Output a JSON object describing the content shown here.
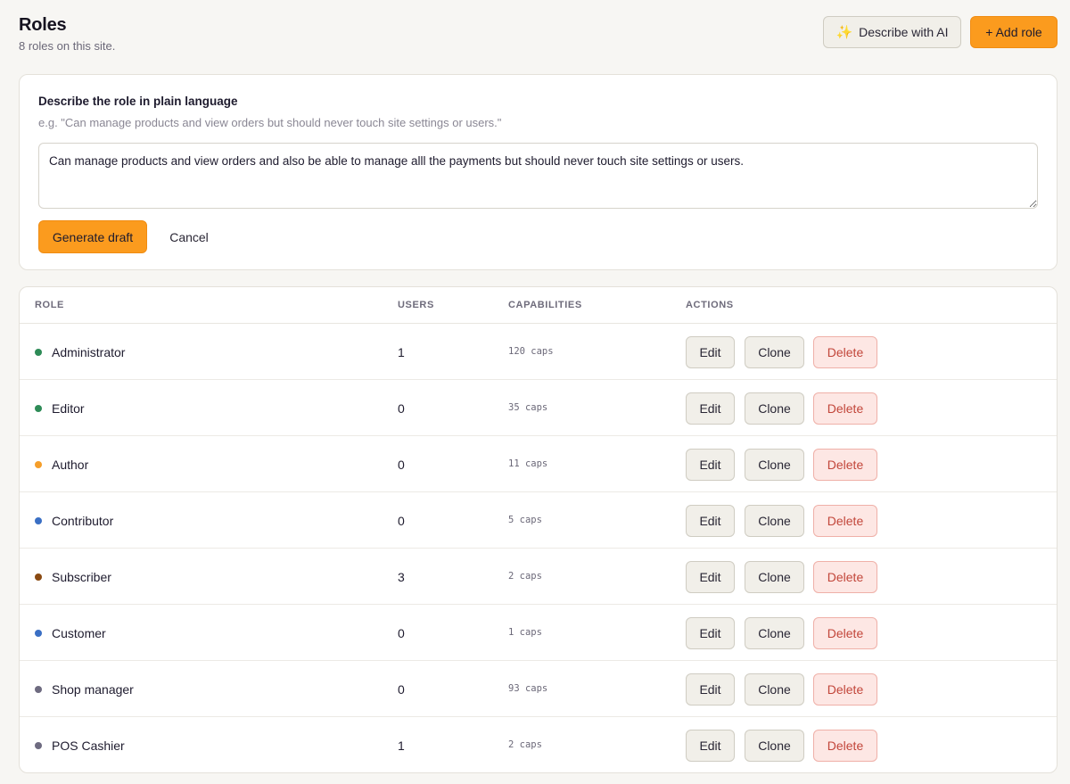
{
  "header": {
    "title": "Roles",
    "subtitle": "8 roles on this site.",
    "describe_ai_label": "Describe with AI",
    "add_role_label": "+ Add role"
  },
  "ai_panel": {
    "label": "Describe the role in plain language",
    "hint": "e.g. \"Can manage products and view orders but should never touch site settings or users.\"",
    "textarea_value": "Can manage products and view orders and also be able to manage alll the payments but should never touch site settings or users.",
    "generate_label": "Generate draft",
    "cancel_label": "Cancel"
  },
  "table": {
    "columns": [
      "ROLE",
      "USERS",
      "CAPABILITIES",
      "ACTIONS"
    ],
    "action_labels": {
      "edit": "Edit",
      "clone": "Clone",
      "delete": "Delete"
    },
    "rows": [
      {
        "name": "Administrator",
        "users": "1",
        "caps": "120 caps",
        "color": "#2e8b57"
      },
      {
        "name": "Editor",
        "users": "0",
        "caps": "35 caps",
        "color": "#2e8b57"
      },
      {
        "name": "Author",
        "users": "0",
        "caps": "11 caps",
        "color": "#f59e2a"
      },
      {
        "name": "Contributor",
        "users": "0",
        "caps": "5 caps",
        "color": "#3a6fc4"
      },
      {
        "name": "Subscriber",
        "users": "3",
        "caps": "2 caps",
        "color": "#8a4a12"
      },
      {
        "name": "Customer",
        "users": "0",
        "caps": "1 caps",
        "color": "#3a6fc4"
      },
      {
        "name": "Shop manager",
        "users": "0",
        "caps": "93 caps",
        "color": "#6e6b80"
      },
      {
        "name": "POS Cashier",
        "users": "1",
        "caps": "2 caps",
        "color": "#6e6b80"
      }
    ]
  },
  "colors": {
    "accent": "#fb9b1e",
    "delete": "#c2463a",
    "background": "#f7f6f3"
  }
}
